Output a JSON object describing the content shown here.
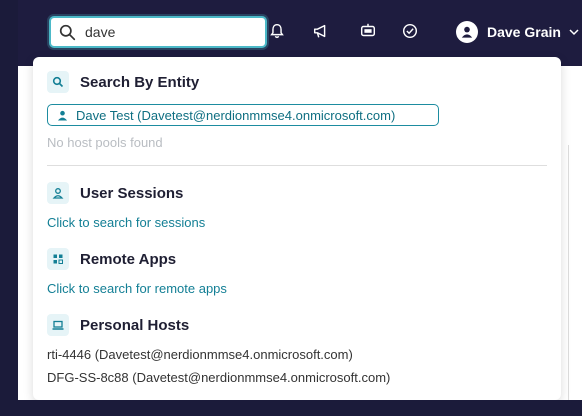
{
  "search": {
    "value": "dave"
  },
  "header": {
    "icons": [
      "bell-icon",
      "megaphone-icon",
      "chat-bot-icon",
      "check-badge-icon"
    ],
    "user_name": "Dave Grain"
  },
  "results": {
    "entity": {
      "title": "Search By Entity",
      "chip": "Dave Test (Davetest@nerdionmmse4.onmicrosoft.com)",
      "empty_note": "No host pools found"
    },
    "user_sessions": {
      "title": "User Sessions",
      "link": "Click to search for sessions"
    },
    "remote_apps": {
      "title": "Remote Apps",
      "link": "Click to search for remote apps"
    },
    "personal_hosts": {
      "title": "Personal Hosts",
      "items": [
        "rti-4446 (Davetest@nerdionmmse4.onmicrosoft.com)",
        "DFG-SS-8c88 (Davetest@nerdionmmse4.onmicrosoft.com)"
      ]
    }
  },
  "colors": {
    "topbar": "#1e1c3f",
    "accent": "#137f95",
    "focus": "#4cb9c8"
  }
}
